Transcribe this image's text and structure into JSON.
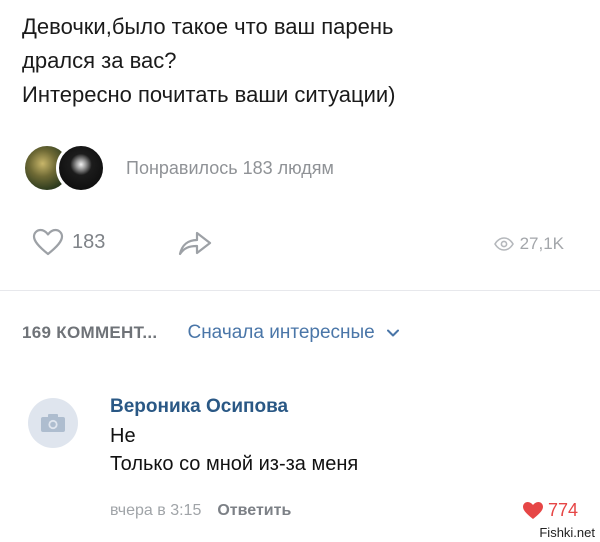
{
  "post": {
    "lines": [
      "Девочки,было такое что ваш парень",
      "дрался за вас?",
      "Интересно почитать ваши ситуации)"
    ],
    "liked_by_text": "Понравилось 183 людям"
  },
  "actions": {
    "like_count": "183",
    "views_count": "27,1K",
    "icons": {
      "like": "heart-outline-icon",
      "share": "share-arrow-icon",
      "views": "eye-icon"
    }
  },
  "comments_bar": {
    "count_label": "169 КОММЕНТ...",
    "sort_label": "Сначала интересные",
    "accent_color": "#4a76a8"
  },
  "comment": {
    "author": "Вероника Осипова",
    "lines": [
      "Не",
      "Только со мной из-за меня"
    ],
    "time": "вчера в 3:15",
    "reply_label": "Ответить",
    "like_count": "774",
    "like_color": "#e64646"
  },
  "watermark": "Fishki.net"
}
